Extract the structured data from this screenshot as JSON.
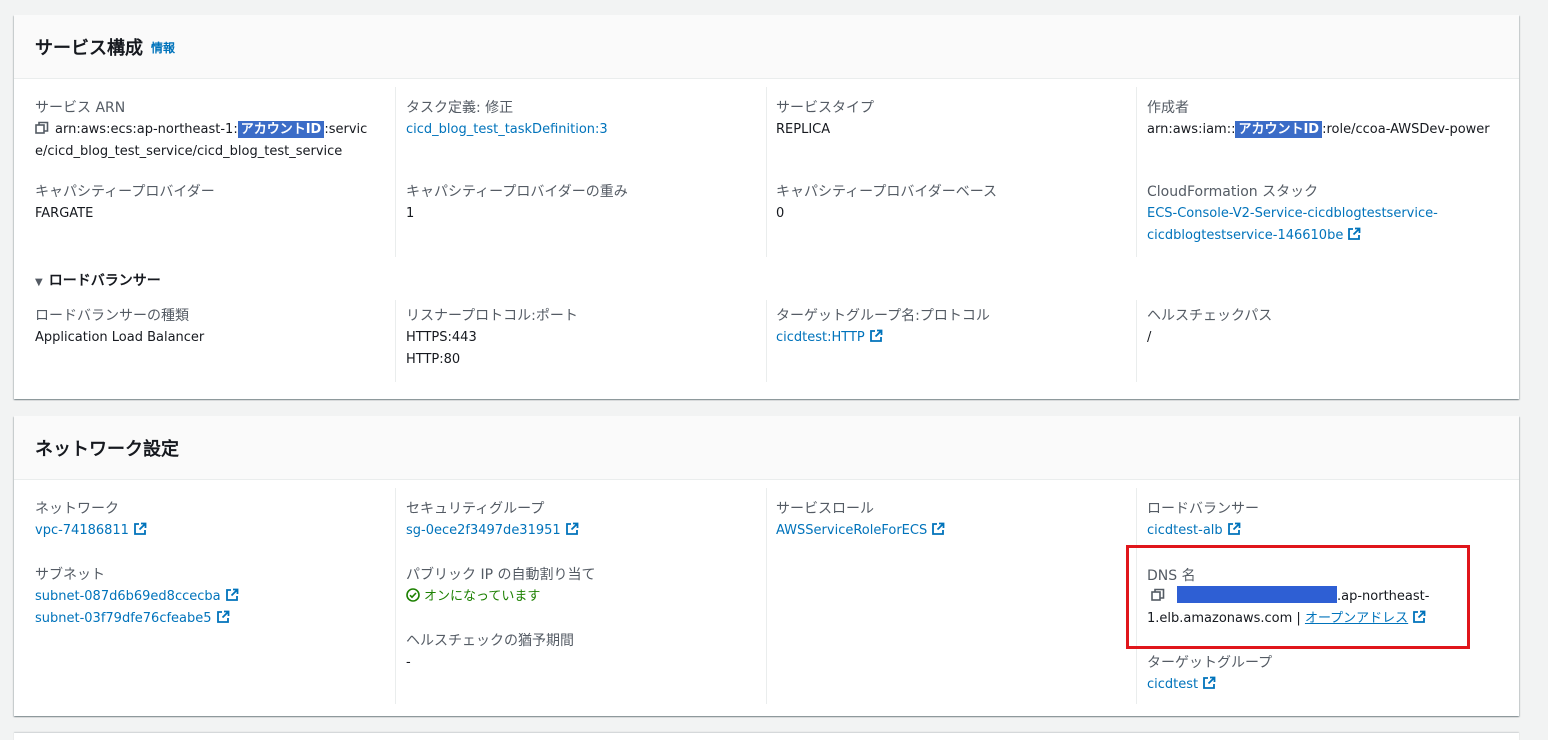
{
  "service_config": {
    "title": "サービス構成",
    "info": "情報",
    "service_arn": {
      "label": "サービス ARN",
      "prefix": "arn:aws:ecs:ap-northeast-1:",
      "masked": "アカウントID",
      "suffix1": ":servic",
      "line2": "e/cicd_blog_test_service/cicd_blog_test_service"
    },
    "task_definition": {
      "label": "タスク定義: 修正",
      "value": "cicd_blog_test_taskDefinition:3"
    },
    "service_type": {
      "label": "サービスタイプ",
      "value": "REPLICA"
    },
    "creator": {
      "label": "作成者",
      "prefix": "arn:aws:iam::",
      "masked": "アカウントID",
      "suffix": ":role/ccoa-AWSDev-power"
    },
    "capacity_provider": {
      "label": "キャパシティープロバイダー",
      "value": "FARGATE"
    },
    "capacity_weight": {
      "label": "キャパシティープロバイダーの重み",
      "value": "1"
    },
    "capacity_base": {
      "label": "キャパシティープロバイダーベース",
      "value": "0"
    },
    "cloudformation": {
      "label": "CloudFormation スタック",
      "line1": "ECS-Console-V2-Service-cicdblogtestservice-",
      "line2": "cicdblogtestservice-146610be"
    },
    "load_balancer_section": "ロードバランサー",
    "lb_type": {
      "label": "ロードバランサーの種類",
      "value": "Application Load Balancer"
    },
    "listener": {
      "label": "リスナープロトコル:ポート",
      "values": [
        "HTTPS:443",
        "HTTP:80"
      ]
    },
    "target_group_proto": {
      "label": "ターゲットグループ名:プロトコル",
      "value": "cicdtest:HTTP"
    },
    "health_path": {
      "label": "ヘルスチェックパス",
      "value": "/"
    }
  },
  "network": {
    "title": "ネットワーク設定",
    "network": {
      "label": "ネットワーク",
      "value": "vpc-74186811"
    },
    "security_group": {
      "label": "セキュリティグループ",
      "value": "sg-0ece2f3497de31951"
    },
    "service_role": {
      "label": "サービスロール",
      "value": "AWSServiceRoleForECS"
    },
    "load_balancer": {
      "label": "ロードバランサー",
      "value": "cicdtest-alb"
    },
    "subnet": {
      "label": "サブネット",
      "values": [
        "subnet-087d6b69ed8ccecba",
        "subnet-03f79dfe76cfeabe5"
      ]
    },
    "public_ip": {
      "label": "パブリック IP の自動割り当て",
      "value": "オンになっています"
    },
    "grace_period": {
      "label": "ヘルスチェックの猶予期間",
      "value": "-"
    },
    "dns": {
      "label": "DNS 名",
      "suffix1": ".ap-northeast-",
      "line2": "1.elb.amazonaws.com",
      "sep": " | ",
      "open": "オープンアドレス"
    },
    "target_group": {
      "label": "ターゲットグループ",
      "value": "cicdtest"
    }
  },
  "colors": {
    "link": "#0073bb",
    "mask": "#3b6cc7",
    "highlight": "#e0161b",
    "success": "#1d8102"
  }
}
